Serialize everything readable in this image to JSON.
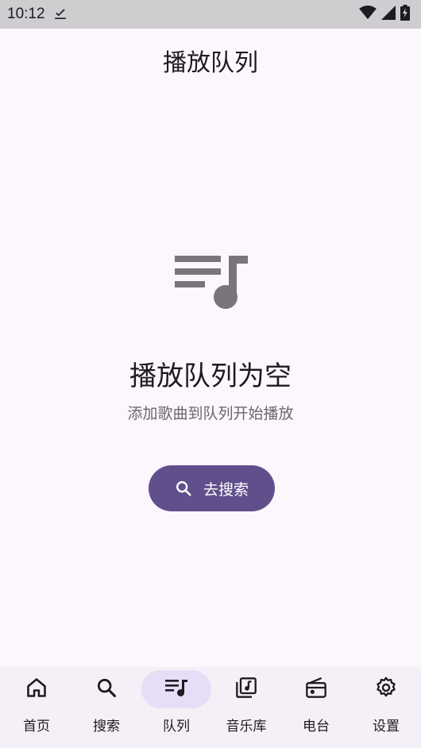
{
  "status_bar": {
    "time": "10:12",
    "icons": [
      "download-done-icon",
      "wifi-icon",
      "signal-icon",
      "battery-charging-icon"
    ]
  },
  "header": {
    "title": "播放队列"
  },
  "empty_state": {
    "icon": "queue-music-icon",
    "title": "播放队列为空",
    "subtitle": "添加歌曲到队列开始播放",
    "button_label": "去搜索",
    "button_icon": "search-icon"
  },
  "bottom_nav": {
    "selected": "队列",
    "items": [
      {
        "label": "首页",
        "icon": "home-icon"
      },
      {
        "label": "搜索",
        "icon": "search-icon"
      },
      {
        "label": "队列",
        "icon": "queue-music-icon"
      },
      {
        "label": "音乐库",
        "icon": "library-music-icon"
      },
      {
        "label": "电台",
        "icon": "radio-icon"
      },
      {
        "label": "设置",
        "icon": "settings-icon"
      }
    ]
  },
  "colors": {
    "background": "#fcf7fc",
    "status_bar": "#cfcdd0",
    "primary_button": "#614f8c",
    "nav_active_pill": "#e6def6",
    "empty_icon": "#79757d"
  }
}
